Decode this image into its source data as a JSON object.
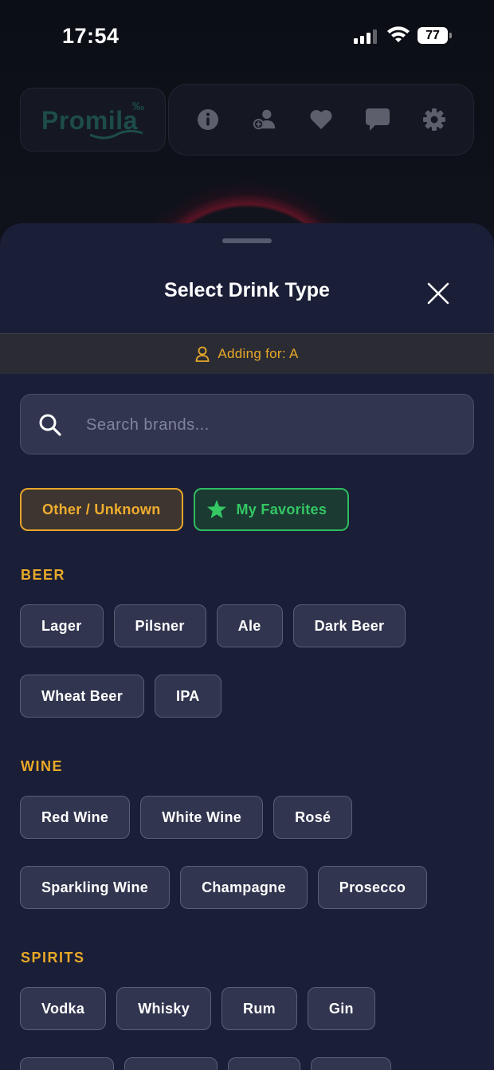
{
  "status_bar": {
    "time": "17:54",
    "battery": "77"
  },
  "app": {
    "logo_text": "Promila",
    "logo_sup": "‰"
  },
  "sheet": {
    "title": "Select Drink Type",
    "adding_for": "Adding for: A",
    "search_placeholder": "Search brands...",
    "quick": {
      "other": "Other / Unknown",
      "favorites": "My Favorites"
    },
    "sections": {
      "beer": {
        "label": "BEER",
        "row1": [
          "Lager",
          "Pilsner",
          "Ale",
          "Dark Beer"
        ],
        "row2": [
          "Wheat Beer",
          "IPA"
        ]
      },
      "wine": {
        "label": "WINE",
        "row1": [
          "Red Wine",
          "White Wine",
          "Rosé"
        ],
        "row2": [
          "Sparkling Wine",
          "Champagne",
          "Prosecco"
        ]
      },
      "spirits": {
        "label": "SPIRITS",
        "row1": [
          "Vodka",
          "Whisky",
          "Rum",
          "Gin"
        ]
      }
    }
  },
  "colors": {
    "accent_gold": "#e9a928",
    "accent_green": "#34c764",
    "sheet_bg": "#1a1e36",
    "chip_bg": "#31354f"
  }
}
